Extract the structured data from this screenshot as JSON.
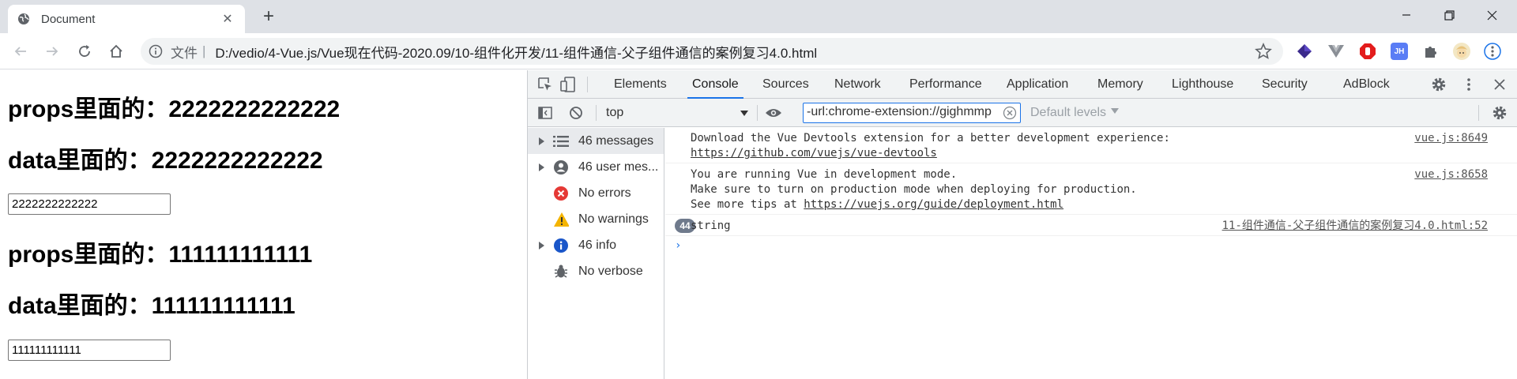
{
  "browser": {
    "tab_title": "Document",
    "tab_close": "✕",
    "new_tab": "+",
    "address_scheme": "文件",
    "address_sep": "|",
    "address_url": "D:/vedio/4-Vue.js/Vue现在代码-2020.09/10-组件化开发/11-组件通信-父子组件通信的案例复习4.0.html",
    "extension_badge": "JH"
  },
  "page": {
    "heading_props_1": "props里面的：2222222222222",
    "heading_data_1": "data里面的：2222222222222",
    "input_1_value": "2222222222222",
    "heading_props_2": "props里面的：111111111111",
    "heading_data_2": "data里面的：111111111111",
    "input_2_value": "111111111111"
  },
  "devtools": {
    "tabs": [
      "Elements",
      "Console",
      "Sources",
      "Network",
      "Performance",
      "Application",
      "Memory",
      "Lighthouse",
      "Security",
      "AdBlock"
    ],
    "active_tab": "Console",
    "context": "top",
    "filter_value": "-url:chrome-extension://gighmmp",
    "levels": "Default levels",
    "sidebar": [
      {
        "label": "46 messages",
        "icon": "list-icon",
        "expandable": true,
        "selected": true
      },
      {
        "label": "46 user mes...",
        "icon": "user-icon",
        "expandable": true,
        "selected": false
      },
      {
        "label": "No errors",
        "icon": "error-icon",
        "expandable": false,
        "selected": false
      },
      {
        "label": "No warnings",
        "icon": "warning-icon",
        "expandable": false,
        "selected": false
      },
      {
        "label": "46 info",
        "icon": "info-icon",
        "expandable": true,
        "selected": false
      },
      {
        "label": "No verbose",
        "icon": "bug-icon",
        "expandable": false,
        "selected": false
      }
    ],
    "messages": [
      {
        "line1": "Download the Vue Devtools extension for a better development experience:",
        "link": "https://github.com/vuejs/vue-devtools",
        "source": "vue.js:8649"
      },
      {
        "line1": "You are running Vue in development mode.",
        "line2": "Make sure to turn on production mode when deploying for production.",
        "line3_prefix": "See more tips at ",
        "link": "https://vuejs.org/guide/deployment.html",
        "source": "vue.js:8658"
      },
      {
        "count": "44",
        "text": "string",
        "source": "11-组件通信-父子组件通信的案例复习4.0.html:52"
      }
    ],
    "prompt": "›"
  }
}
